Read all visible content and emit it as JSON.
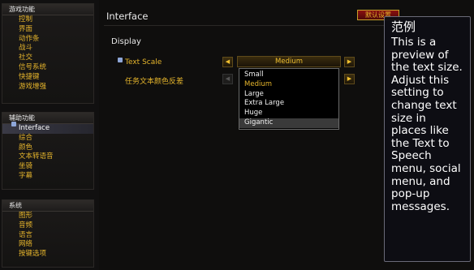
{
  "sidebar": {
    "groups": [
      {
        "header": "游戏功能",
        "items": [
          "控制",
          "界面",
          "动作条",
          "战斗",
          "社交",
          "信号系统",
          "快捷键",
          "游戏增强"
        ]
      },
      {
        "header": "辅助功能",
        "items": [
          "Interface",
          "综合",
          "颜色",
          "文本转语音",
          "坐骑",
          "字幕"
        ],
        "selected_index": 0
      },
      {
        "header": "系统",
        "items": [
          "图形",
          "音频",
          "语言",
          "网络",
          "按键选项"
        ]
      }
    ]
  },
  "main": {
    "title": "Interface",
    "defaults_button": "默认设置",
    "section": "Display",
    "text_scale": {
      "label": "Text Scale",
      "value": "Medium",
      "options": [
        "Small",
        "Medium",
        "Large",
        "Extra Large",
        "Huge",
        "Gigantic"
      ],
      "current": "Medium",
      "hover": "Gigantic"
    },
    "invert_quest_color": {
      "label": "任务文本颜色反差"
    },
    "arrows": {
      "left": "◀",
      "right": "▶"
    }
  },
  "tooltip": {
    "title": "范例",
    "body": "This is a preview of the text size. Adjust this setting to change text size in places like the Text to Speech menu, social menu, and pop-up messages."
  },
  "colors": {
    "accent_gold": "#e6b52c",
    "background": "#0d0c0b",
    "selected_marker": "#8ea6d8",
    "defaults_button": "#8a1010"
  },
  "icons": {
    "selected_item": "selected-square-icon",
    "arrow_left": "arrow-left-icon",
    "arrow_right": "arrow-right-icon"
  }
}
